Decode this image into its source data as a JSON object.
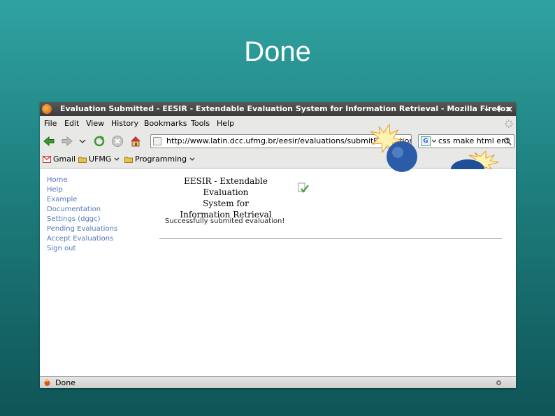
{
  "slide": {
    "title": "Done"
  },
  "window": {
    "title": "Evaluation Submitted - EESIR - Extendable Evaluation System for Information Retrieval - Mozilla Firefox",
    "controls": [
      "–",
      "+",
      "×"
    ]
  },
  "menu": [
    "File",
    "Edit",
    "View",
    "History",
    "Bookmarks",
    "Tools",
    "Help"
  ],
  "toolbar": {
    "url": "http://www.latin.dcc.ufmg.br/eesir/evaluations/submitEvaluation.",
    "search": "css make html ent"
  },
  "bookmarks": [
    "Gmail",
    "UFMG",
    "Programming"
  ],
  "sidebar": {
    "items": [
      "Home",
      "Help",
      "Example",
      "Documentation",
      "Settings (dggc)",
      "Pending Evaluations",
      "Accept Evaluations",
      "Sign out"
    ]
  },
  "page": {
    "title_lines": [
      "EESIR - Extendable Evaluation",
      "System for",
      "Information Retrieval"
    ],
    "message": "Successfully submited evaluation!"
  },
  "status": {
    "text": "Done"
  },
  "colors": {
    "accent": "#2fa3a1",
    "link": "#5577bb"
  }
}
